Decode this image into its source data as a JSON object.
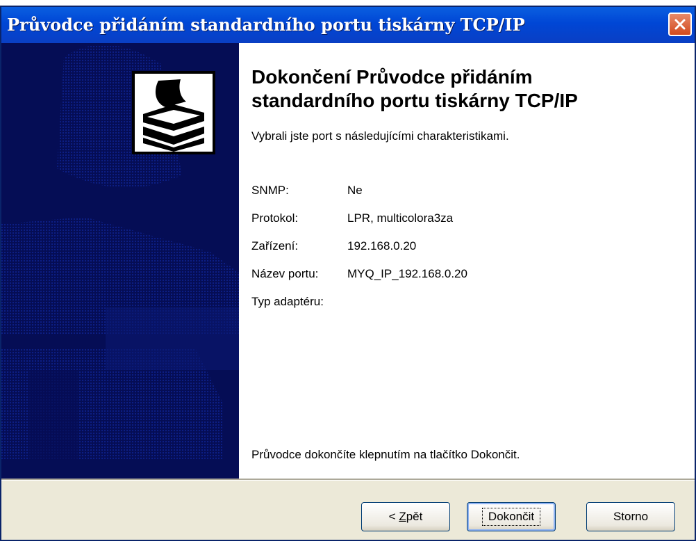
{
  "window": {
    "title": "Průvodce přidáním standardního portu tiskárny TCP/IP"
  },
  "main": {
    "heading_line1": "Dokončení Průvodce přidáním",
    "heading_line2": "standardního portu tiskárny TCP/IP",
    "intro": "Vybrali jste port s následujícími charakteristikami.",
    "details": [
      {
        "label": "SNMP:",
        "value": "Ne"
      },
      {
        "label": "Protokol:",
        "value": "LPR, multicolora3za"
      },
      {
        "label": "Zařízení:",
        "value": "192.168.0.20"
      },
      {
        "label": "Název portu:",
        "value": "MYQ_IP_192.168.0.20"
      },
      {
        "label": "Typ adaptéru:",
        "value": ""
      }
    ],
    "finish_hint": "Průvodce dokončíte klepnutím na tlačítko Dokončit."
  },
  "buttons": {
    "back_prefix": "< ",
    "back_accel": "Z",
    "back_rest": "pět",
    "finish": "Dokončit",
    "cancel": "Storno"
  },
  "icons": {
    "close": "close-icon",
    "printer": "printer-icon",
    "banner": "printer-banner-graphic"
  },
  "colors": {
    "titlebar": "#0046d5",
    "banner": "#050d55",
    "close_button": "#d24a1e",
    "dialog_face": "#ece9d8"
  }
}
